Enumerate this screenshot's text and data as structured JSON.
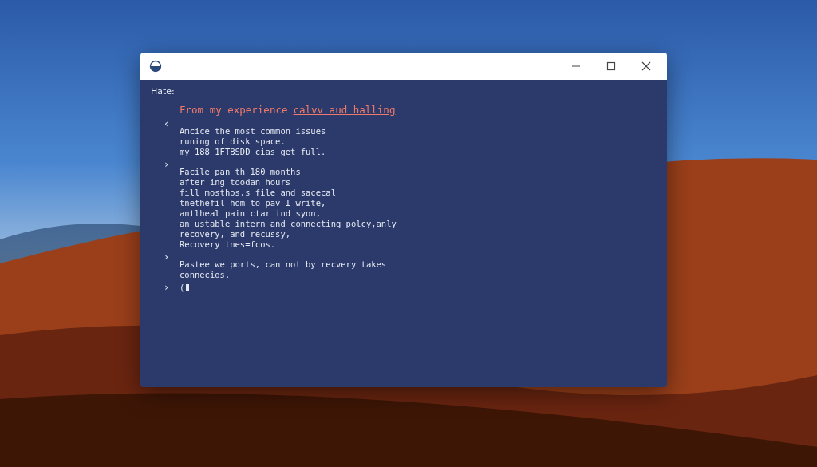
{
  "window": {
    "controls": [
      {
        "kind": "minimize"
      },
      {
        "kind": "maximize"
      },
      {
        "kind": "close"
      }
    ]
  },
  "terminal": {
    "prompt": "Hate:",
    "heading": {
      "text": "From my experience",
      "link": "calvv aud halling"
    },
    "blocks": [
      {
        "marker": "‹",
        "lines": [
          "Amcice the most common issues",
          "runing of disk space.",
          "my 188 1FTBSDD cias get full."
        ]
      },
      {
        "marker": "›",
        "lines": [
          "Facile pan th 180 months",
          "after ing toodan hours",
          "fill mosthos,s file and sacecal",
          "tnethefil hom to pav I write,",
          "antlheal pain ctar ind syon,",
          "an ustable intern and connecting polcy,anly",
          "recovery, and recussy,",
          "Recovery tnes=fcos."
        ]
      },
      {
        "marker": "›",
        "lines": [
          "Pastee we ports, can not by recvery takes",
          "connecios."
        ]
      }
    ],
    "input": {
      "marker": "›",
      "text": "("
    }
  }
}
